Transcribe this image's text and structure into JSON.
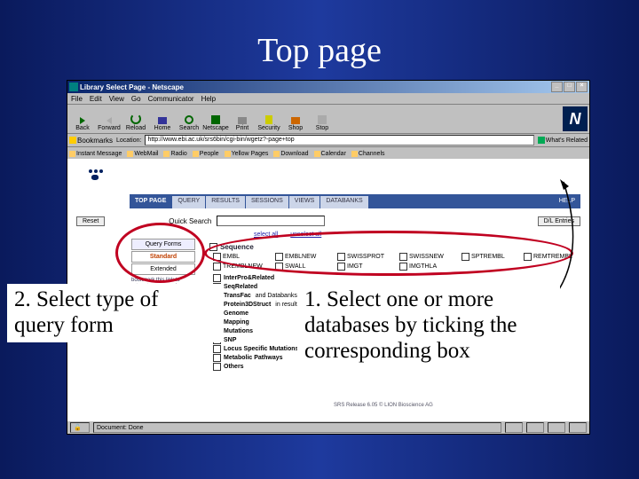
{
  "slide_title": "Top page",
  "window": {
    "title": "Library Select Page - Netscape"
  },
  "menubar": [
    "File",
    "Edit",
    "View",
    "Go",
    "Communicator",
    "Help"
  ],
  "toolbar": [
    {
      "label": "Back"
    },
    {
      "label": "Forward"
    },
    {
      "label": "Reload"
    },
    {
      "label": "Home"
    },
    {
      "label": "Search"
    },
    {
      "label": "Netscape"
    },
    {
      "label": "Print"
    },
    {
      "label": "Security"
    },
    {
      "label": "Shop"
    },
    {
      "label": "Stop"
    }
  ],
  "addressbar": {
    "bookmarks_label": "Bookmarks",
    "location_label": "Location:",
    "location_value": "http://www.ebi.ac.uk/srs6bin/cgi-bin/wgetz?-page+top",
    "related_label": "What's Related"
  },
  "linkbar": [
    "Instant Message",
    "WebMail",
    "Radio",
    "People",
    "Yellow Pages",
    "Download",
    "Calendar",
    "Channels"
  ],
  "nav_tabs": {
    "items": [
      "TOP PAGE",
      "QUERY",
      "RESULTS",
      "SESSIONS",
      "VIEWS",
      "DATABANKS"
    ],
    "help": "HELP"
  },
  "quick_search": {
    "reset_label": "Reset",
    "label": "Quick Search",
    "dl_label": "D/L Entries"
  },
  "sidebar": {
    "header": "Query Forms",
    "standard": "Standard",
    "extended": "Extended",
    "note": "bookmark this link to return to your session"
  },
  "select_row": {
    "select_all": "select all",
    "unselect_all": "unselect all"
  },
  "categories": {
    "sequence": {
      "title": "Sequence",
      "items": [
        "EMBL",
        "EMBLNEW",
        "SWISSPROT",
        "SWISSNEW",
        "SPTREMBL",
        "REMTREMBL",
        "TREMBLNEW",
        "SWALL",
        "IMGT",
        "IMGTHLA"
      ]
    },
    "list": [
      "InterPro&Related",
      "SeqRelated",
      "TransFac",
      "Protein3DStruct",
      "Genome",
      "Mapping",
      "Mutations",
      "SNP",
      "Locus Specific Mutations",
      "Metabolic Pathways",
      "Others"
    ],
    "extra_line": "and Databanks",
    "extra_line2": "in results"
  },
  "footer_label": "SRS Release 6.05   © LION Bioscience AG",
  "statusbar": {
    "doc_done": "Document: Done"
  },
  "callouts": {
    "left": "2. Select type of query form",
    "right": "1. Select one or more databases by ticking the corresponding box"
  }
}
